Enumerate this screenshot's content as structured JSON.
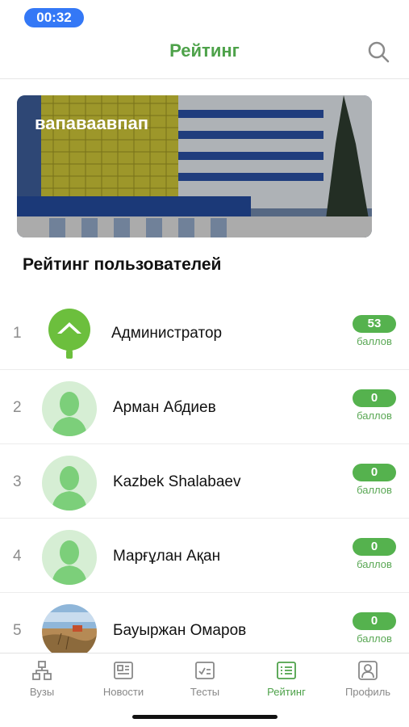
{
  "status": {
    "time": "00:32"
  },
  "header": {
    "title": "Рейтинг",
    "search_icon": "search-icon"
  },
  "banner": {
    "title": "вапаваавпап"
  },
  "section": {
    "title": "Рейтинг пользователей"
  },
  "users": [
    {
      "rank": "1",
      "name": "Администратор",
      "points": "53",
      "points_label": "баллов",
      "avatar": "logo-avatar"
    },
    {
      "rank": "2",
      "name": "Арман Абдиев",
      "points": "0",
      "points_label": "баллов",
      "avatar": "default-avatar"
    },
    {
      "rank": "3",
      "name": "Kazbek Shalabaev",
      "points": "0",
      "points_label": "баллов",
      "avatar": "default-avatar"
    },
    {
      "rank": "4",
      "name": "Марғұлан Ақан",
      "points": "0",
      "points_label": "баллов",
      "avatar": "default-avatar"
    },
    {
      "rank": "5",
      "name": "Бауыржан Омаров",
      "points": "0",
      "points_label": "баллов",
      "avatar": "photo-avatar"
    }
  ],
  "tabbar": {
    "tabs": [
      {
        "label": "Вузы",
        "icon": "network-icon",
        "active": false
      },
      {
        "label": "Новости",
        "icon": "newspaper-icon",
        "active": false
      },
      {
        "label": "Тесты",
        "icon": "test-icon",
        "active": false
      },
      {
        "label": "Рейтинг",
        "icon": "list-icon",
        "active": true
      },
      {
        "label": "Профиль",
        "icon": "profile-icon",
        "active": false
      }
    ]
  },
  "colors": {
    "accent": "#4ea24a",
    "pill": "#55b24e",
    "time_badge": "#3478f6",
    "avatar_bg": "#d6eed4"
  }
}
